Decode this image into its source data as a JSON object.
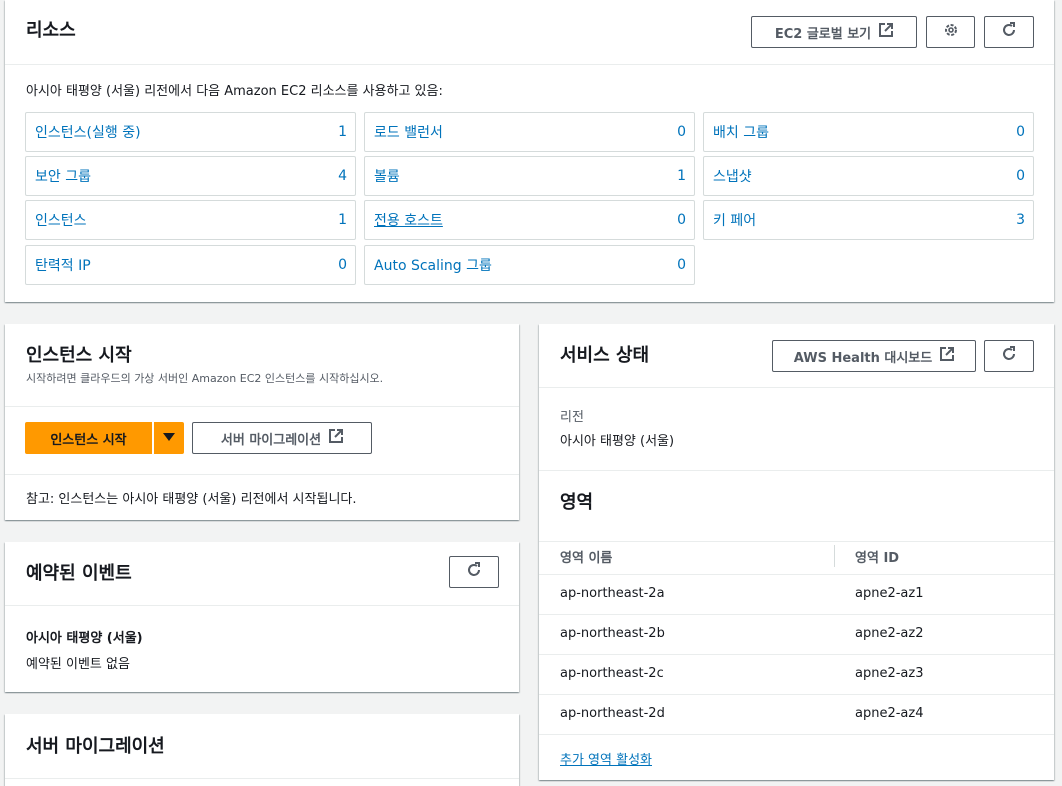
{
  "resources": {
    "title": "리소스",
    "global_view_label": "EC2 글로벌 보기",
    "description": "아시아 태평양 (서울) 리전에서 다음 Amazon EC2 리소스를 사용하고 있음:",
    "items": [
      {
        "label": "인스턴스(실행 중)",
        "count": "1"
      },
      {
        "label": "로드 밸런서",
        "count": "0"
      },
      {
        "label": "배치 그룹",
        "count": "0"
      },
      {
        "label": "보안 그룹",
        "count": "4"
      },
      {
        "label": "볼륨",
        "count": "1"
      },
      {
        "label": "스냅샷",
        "count": "0"
      },
      {
        "label": "인스턴스",
        "count": "1"
      },
      {
        "label": "전용 호스트",
        "count": "0"
      },
      {
        "label": "키 페어",
        "count": "3"
      },
      {
        "label": "탄력적 IP",
        "count": "0"
      },
      {
        "label": "Auto Scaling 그룹",
        "count": "0"
      }
    ]
  },
  "launch": {
    "title": "인스턴스 시작",
    "subtitle": "시작하려면 클라우드의 가상 서버인 Amazon EC2 인스턴스를 시작하십시오.",
    "launch_label": "인스턴스 시작",
    "migration_label": "서버 마이그레이션",
    "note": "참고: 인스턴스는 아시아 태평양 (서울) 리전에서 시작됩니다."
  },
  "events": {
    "title": "예약된 이벤트",
    "region": "아시아 태평양 (서울)",
    "empty": "예약된 이벤트 없음"
  },
  "migration": {
    "title": "서버 마이그레이션"
  },
  "health": {
    "title": "서비스 상태",
    "dashboard_label": "AWS Health 대시보드",
    "region_label": "리전",
    "region_value": "아시아 태평양 (서울)",
    "zones_title": "영역",
    "col_name": "영역 이름",
    "col_id": "영역 ID",
    "zones": [
      {
        "name": "ap-northeast-2a",
        "id": "apne2-az1"
      },
      {
        "name": "ap-northeast-2b",
        "id": "apne2-az2"
      },
      {
        "name": "ap-northeast-2c",
        "id": "apne2-az3"
      },
      {
        "name": "ap-northeast-2d",
        "id": "apne2-az4"
      }
    ],
    "enable_label": "추가 영역 활성화"
  },
  "colors": {
    "link": "#0073bb",
    "primary": "#ff9900",
    "text": "#16191f",
    "border": "#545b64"
  },
  "icons": [
    "external-link-icon",
    "gear-icon",
    "refresh-icon",
    "caret-down-icon"
  ]
}
